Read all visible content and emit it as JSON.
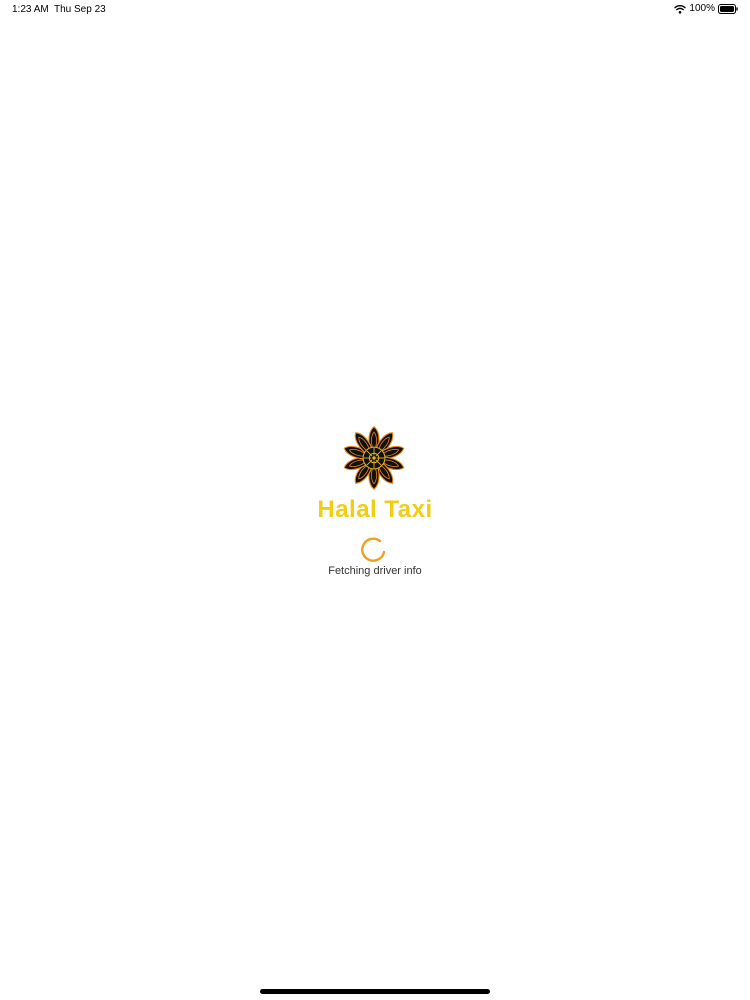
{
  "status_bar": {
    "time": "1:23 AM",
    "date": "Thu Sep 23",
    "battery": "100%",
    "icons": [
      "wifi-icon",
      "battery-icon"
    ]
  },
  "splash": {
    "logo_icon": "ornamental-flower-logo",
    "title": "Halal Taxi",
    "loading_message": "Fetching driver info",
    "spinner_icon": "loading-spinner-icon"
  },
  "colors": {
    "title": "#f2cd12",
    "spinner": "#f0a01e",
    "logo_dark": "#111111",
    "logo_accent": "#f08a1c",
    "logo_gold": "#e6b422"
  }
}
